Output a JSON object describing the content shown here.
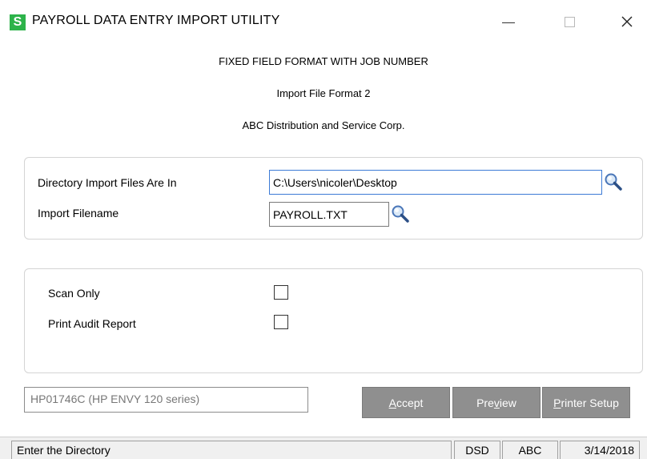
{
  "window": {
    "icon_letter": "S",
    "title": "PAYROLL DATA ENTRY IMPORT UTILITY",
    "minimize_icon": "minimize-icon",
    "maximize_icon": "maximize-icon",
    "close_icon": "close-icon",
    "close_glyph": "✕"
  },
  "header": {
    "line1": "FIXED FIELD FORMAT WITH JOB NUMBER",
    "line2": "Import File Format 2",
    "line3": "ABC Distribution and Service Corp."
  },
  "import_settings": {
    "directory_label": "Directory Import Files Are In",
    "directory_value": "C:\\Users\\nicoler\\Desktop",
    "filename_label": "Import Filename",
    "filename_value": "PAYROLL.TXT",
    "lookup_icon": "magnifier-icon"
  },
  "options": {
    "scan_only_label": "Scan Only",
    "scan_only_checked": false,
    "print_audit_label": "Print Audit Report",
    "print_audit_checked": false
  },
  "footer": {
    "printer_value": "HP01746C (HP ENVY 120 series)",
    "accept_label_prefix": "",
    "accept_label_underline": "A",
    "accept_label_rest": "ccept",
    "preview_label_prefix": "Pre",
    "preview_label_underline": "v",
    "preview_label_rest": "iew",
    "printer_setup_label_prefix": "",
    "printer_setup_label_underline": "P",
    "printer_setup_label_rest": "rinter Setup"
  },
  "status_bar": {
    "message": "Enter the Directory",
    "module": "DSD",
    "company": "ABC",
    "date": "3/14/2018"
  },
  "colors": {
    "app_icon_bg": "#2db34a",
    "button_bg": "#8f8f8f",
    "active_input_border": "#3d7bd6"
  }
}
